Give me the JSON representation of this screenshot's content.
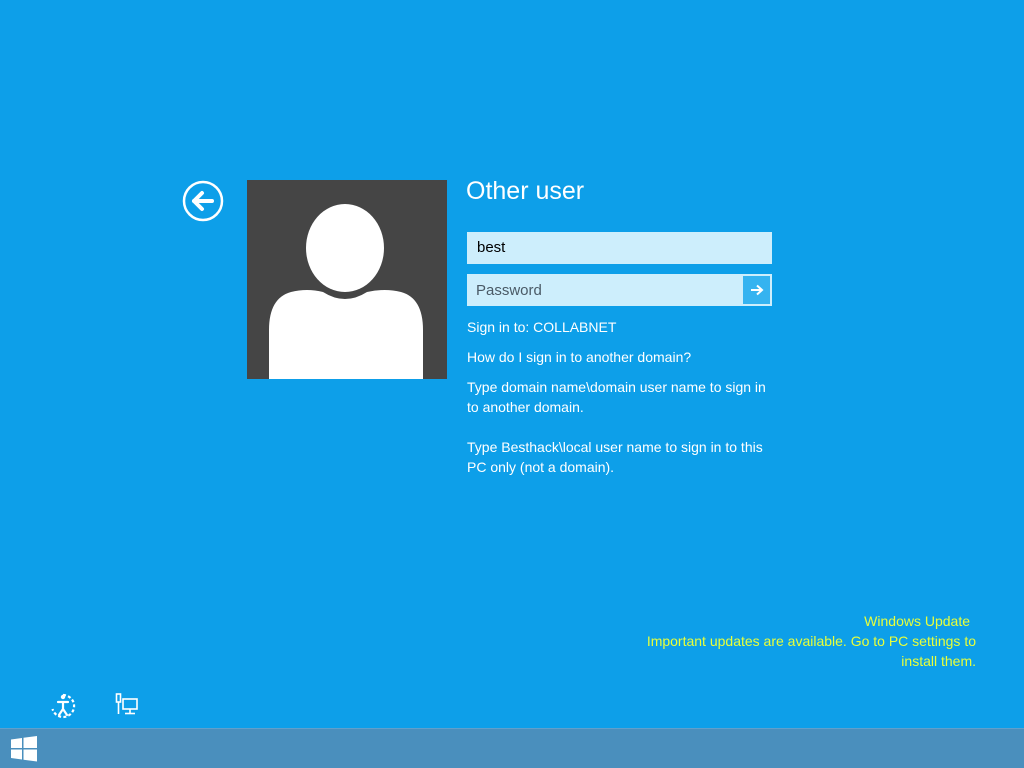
{
  "login": {
    "title": "Other user",
    "username_value": "best",
    "password_placeholder": "Password",
    "sign_in_to": "Sign in to: COLLABNET",
    "help_link": "How do I sign in to another domain?",
    "help_text_1_line1": "Type domain name\\domain user name to sign in",
    "help_text_1_line2": "to another domain.",
    "help_text_2_line1": "Type Besthack\\local user name to sign in to this",
    "help_text_2_line2": "PC only (not a domain)."
  },
  "windows_update": {
    "title": "Windows Update",
    "line1": "Important updates are available. Go to PC settings to",
    "line2": "install them."
  },
  "icons": {
    "back": "back-arrow-icon",
    "submit": "arrow-right-icon",
    "ease_of_access": "ease-of-access-icon",
    "network": "network-icon",
    "start": "windows-logo-icon",
    "avatar": "user-silhouette-icon"
  },
  "colors": {
    "background": "#0d9fe9",
    "avatar_bg": "#454545",
    "input_bg": "#cdeefc",
    "submit_bg": "#35b3f0",
    "update_text": "#e8ff3a",
    "taskbar": "#4a8fbd"
  }
}
